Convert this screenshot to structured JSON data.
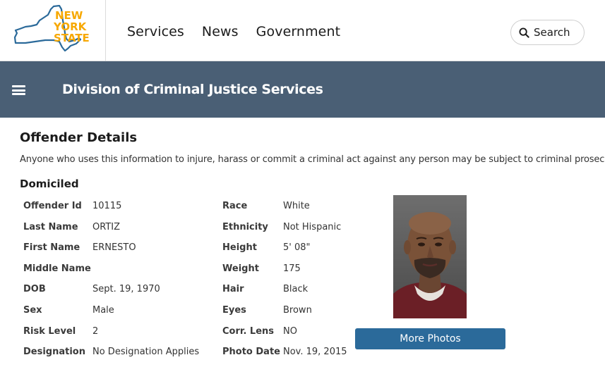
{
  "header": {
    "logo": {
      "line1": "NEW",
      "line2": "YORK",
      "line3": "STATE",
      "icon": "ny-state-outline-logo",
      "accent": "#f7a800",
      "outline": "#2b6a9a"
    },
    "nav": [
      {
        "label": "Services"
      },
      {
        "label": "News"
      },
      {
        "label": "Government"
      }
    ],
    "search_label": "Search",
    "search_icon": "search-icon"
  },
  "agency": {
    "menu_icon": "hamburger-menu-icon",
    "title": "Division of Criminal Justice Services",
    "background": "#4a5f75"
  },
  "page": {
    "title": "Offender Details",
    "warning": "Anyone who uses this information to injure, harass or commit a criminal act against any person may be subject to criminal prosecution.",
    "section_title": "Domiciled"
  },
  "details_left": [
    {
      "label": "Offender Id",
      "value": "10115"
    },
    {
      "label": "Last Name",
      "value": "ORTIZ"
    },
    {
      "label": "First Name",
      "value": "ERNESTO"
    },
    {
      "label": "Middle Name",
      "value": ""
    },
    {
      "label": "DOB",
      "value": "Sept. 19, 1970"
    },
    {
      "label": "Sex",
      "value": "Male"
    },
    {
      "label": "Risk Level",
      "value": "2"
    },
    {
      "label": "Designation",
      "value": "No Designation Applies"
    }
  ],
  "details_right": [
    {
      "label": "Race",
      "value": "White"
    },
    {
      "label": "Ethnicity",
      "value": "Not Hispanic"
    },
    {
      "label": "Height",
      "value": "5' 08\""
    },
    {
      "label": "Weight",
      "value": "175"
    },
    {
      "label": "Hair",
      "value": "Black"
    },
    {
      "label": "Eyes",
      "value": "Brown"
    },
    {
      "label": "Corr. Lens",
      "value": "NO"
    },
    {
      "label": "Photo Date",
      "value": "Nov. 19, 2015"
    }
  ],
  "photo": {
    "button_label": "More Photos",
    "button_color": "#2b6a9a"
  }
}
